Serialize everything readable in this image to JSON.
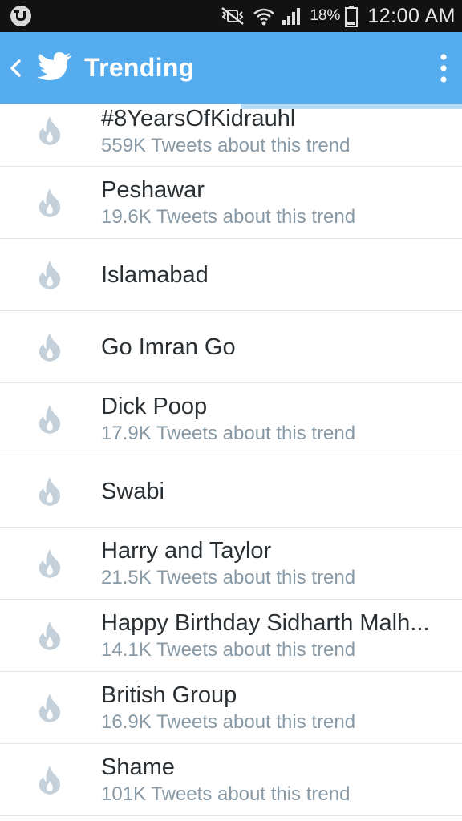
{
  "status_bar": {
    "battery_percent": "18%",
    "time": "12:00 AM"
  },
  "app_bar": {
    "title": "Trending"
  },
  "colors": {
    "brand_blue": "#55acee",
    "status_bar_bg": "#121212",
    "primary_text": "#292f33",
    "secondary_text": "#8899a6",
    "flame_icon": "#c4d1da"
  },
  "trends": [
    {
      "name": "#8YearsOfKidrauhl",
      "subtitle": "559K Tweets about this trend"
    },
    {
      "name": "Peshawar",
      "subtitle": "19.6K Tweets about this trend"
    },
    {
      "name": "Islamabad",
      "subtitle": ""
    },
    {
      "name": "Go Imran Go",
      "subtitle": ""
    },
    {
      "name": "Dick Poop",
      "subtitle": "17.9K Tweets about this trend"
    },
    {
      "name": "Swabi",
      "subtitle": ""
    },
    {
      "name": "Harry and Taylor",
      "subtitle": "21.5K Tweets about this trend"
    },
    {
      "name": "Happy Birthday Sidharth Malh...",
      "subtitle": "14.1K Tweets about this trend"
    },
    {
      "name": "British Group",
      "subtitle": "16.9K Tweets about this trend"
    },
    {
      "name": "Shame",
      "subtitle": "101K Tweets about this trend"
    }
  ]
}
